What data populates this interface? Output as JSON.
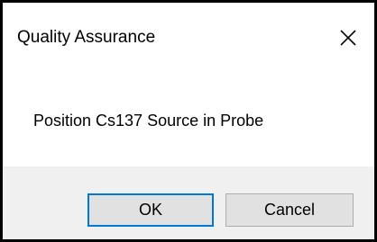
{
  "dialog": {
    "title": "Quality Assurance",
    "close_icon": "close-icon",
    "message": "Position Cs137 Source in Probe",
    "buttons": {
      "ok_label": "OK",
      "cancel_label": "Cancel"
    },
    "colors": {
      "footer_background": "#f0f0f0",
      "button_background": "#e1e1e1",
      "default_button_border": "#0078d7"
    }
  }
}
